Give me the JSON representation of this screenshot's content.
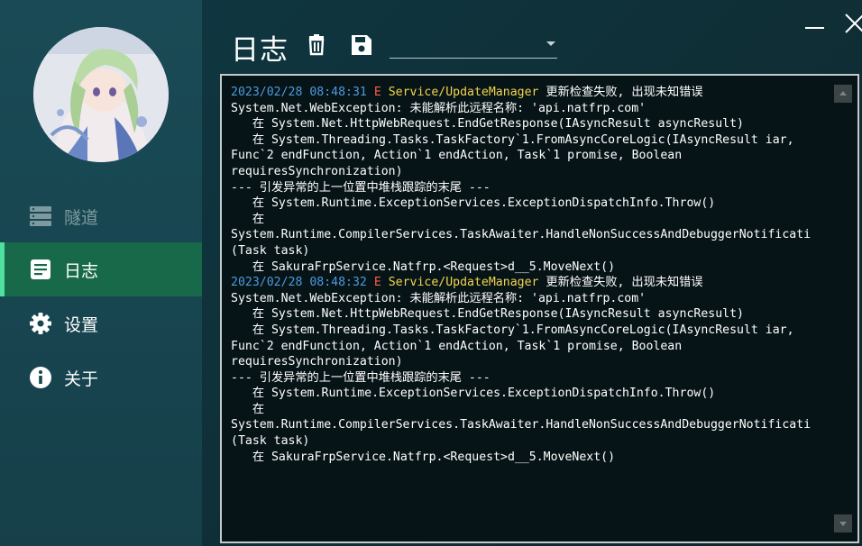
{
  "sidebar": {
    "items": [
      {
        "label": "隧道",
        "icon": "server-icon",
        "state": "disabled"
      },
      {
        "label": "日志",
        "icon": "document-icon",
        "state": "active"
      },
      {
        "label": "设置",
        "icon": "gear-icon",
        "state": "normal"
      },
      {
        "label": "关于",
        "icon": "info-icon",
        "state": "normal"
      }
    ]
  },
  "header": {
    "title": "日志",
    "delete_icon": "trash-icon",
    "save_icon": "save-icon",
    "filter_value": ""
  },
  "window": {
    "minimize_icon": "minimize-icon",
    "close_icon": "close-icon"
  },
  "log": {
    "entries": [
      {
        "time": "2023/02/28 08:48:31",
        "level": "E",
        "source": "Service/UpdateManager",
        "message": "更新检查失败, 出现未知错误",
        "details": "System.Net.WebException: 未能解析此远程名称: 'api.natfrp.com'\n   在 System.Net.HttpWebRequest.EndGetResponse(IAsyncResult asyncResult)\n   在 System.Threading.Tasks.TaskFactory`1.FromAsyncCoreLogic(IAsyncResult iar,\nFunc`2 endFunction, Action`1 endAction, Task`1 promise, Boolean\nrequiresSynchronization)\n--- 引发异常的上一位置中堆栈跟踪的末尾 ---\n   在 System.Runtime.ExceptionServices.ExceptionDispatchInfo.Throw()\n   在\nSystem.Runtime.CompilerServices.TaskAwaiter.HandleNonSuccessAndDebuggerNotificati\n(Task task)\n   在 SakuraFrpService.Natfrp.<Request>d__5.MoveNext()"
      },
      {
        "time": "2023/02/28 08:48:32",
        "level": "E",
        "source": "Service/UpdateManager",
        "message": "更新检查失败, 出现未知错误",
        "details": "System.Net.WebException: 未能解析此远程名称: 'api.natfrp.com'\n   在 System.Net.HttpWebRequest.EndGetResponse(IAsyncResult asyncResult)\n   在 System.Threading.Tasks.TaskFactory`1.FromAsyncCoreLogic(IAsyncResult iar,\nFunc`2 endFunction, Action`1 endAction, Task`1 promise, Boolean\nrequiresSynchronization)\n--- 引发异常的上一位置中堆栈跟踪的末尾 ---\n   在 System.Runtime.ExceptionServices.ExceptionDispatchInfo.Throw()\n   在\nSystem.Runtime.CompilerServices.TaskAwaiter.HandleNonSuccessAndDebuggerNotificati\n(Task task)\n   在 SakuraFrpService.Natfrp.<Request>d__5.MoveNext()"
      }
    ]
  },
  "colors": {
    "accent": "#4fe0a1",
    "active_bg": "#17694a",
    "time_color": "#4a9be0",
    "error_color": "#ff5a4a",
    "source_color": "#f2d44e"
  }
}
